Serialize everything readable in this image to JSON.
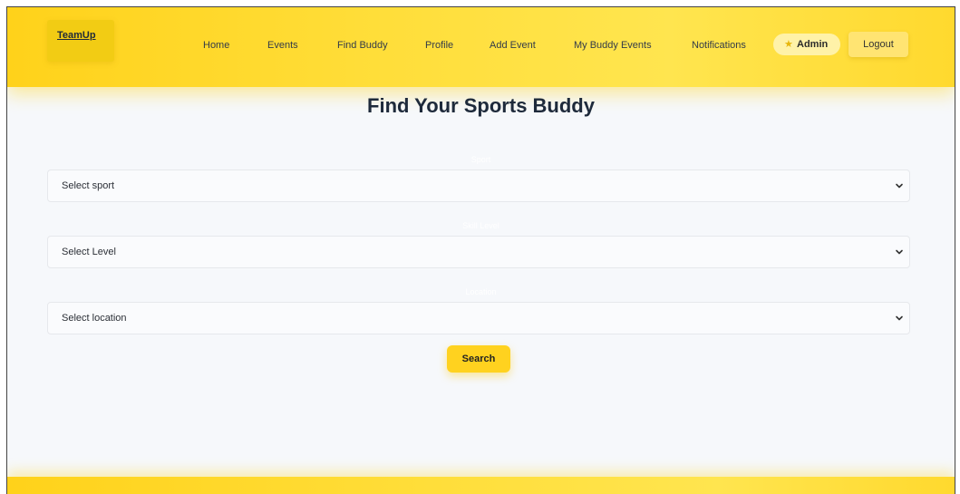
{
  "nav": {
    "logo": "TeamUp",
    "links": [
      "Home",
      "Events",
      "Find Buddy",
      "Profile",
      "Add Event",
      "My Buddy Events",
      "Notifications"
    ],
    "admin_label": "Admin",
    "admin_icon": "star-icon",
    "logout_label": "Logout"
  },
  "page": {
    "title": "Find Your Sports Buddy"
  },
  "form": {
    "sport": {
      "label": "Sport",
      "selected": "Select sport"
    },
    "level": {
      "label": "Skill Level",
      "selected": "Select Level"
    },
    "location": {
      "label": "Location",
      "selected": "Select location"
    },
    "search_label": "Search"
  },
  "colors": {
    "accent": "#ffd21a",
    "title_text": "#1e2a3b",
    "page_bg": "#f6f8fb"
  }
}
